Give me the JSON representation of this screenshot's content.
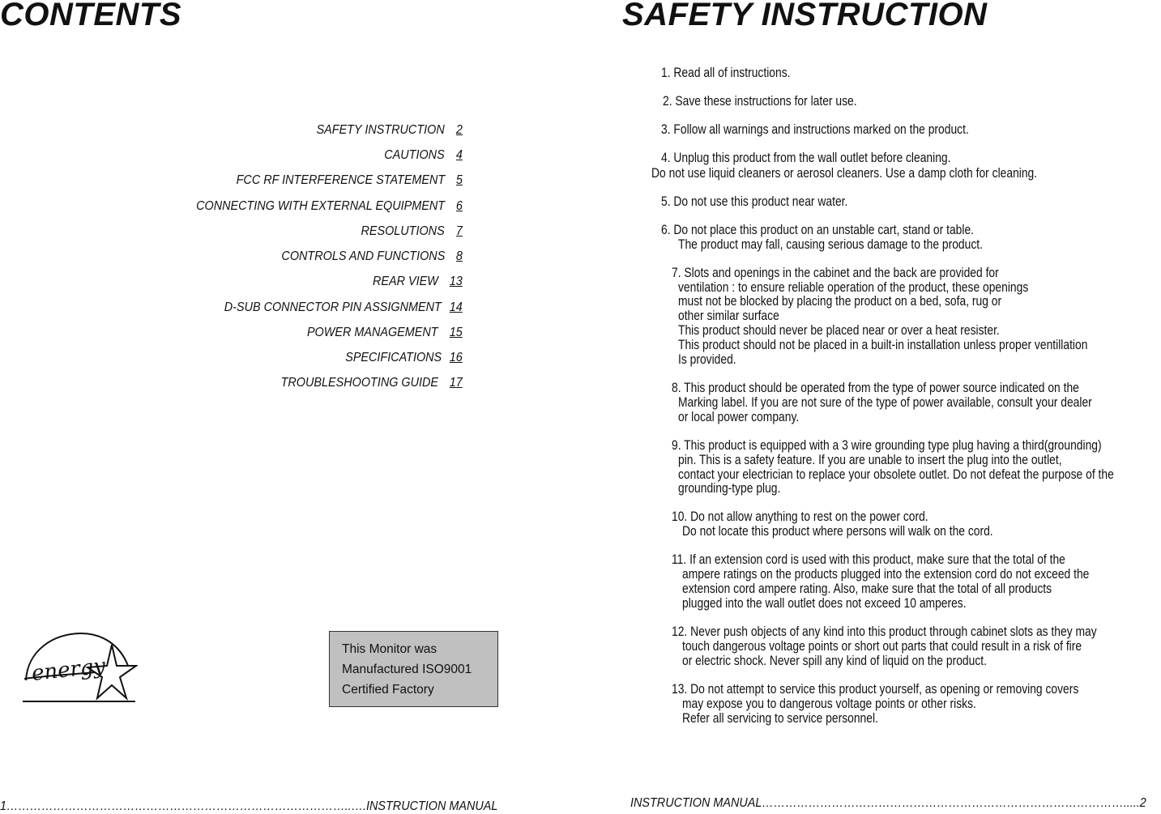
{
  "left_page": {
    "title": "CONTENTS",
    "toc": [
      {
        "title": "SAFETY INSTRUCTION",
        "page": "2"
      },
      {
        "title": "CAUTIONS",
        "page": "4"
      },
      {
        "title": "FCC RF INTERFERENCE STATEMENT",
        "page": "5"
      },
      {
        "title": "CONNECTING WITH EXTERNAL EQUIPMENT",
        "page": "6"
      },
      {
        "title": "RESOLUTIONS",
        "page": "7"
      },
      {
        "title": "CONTROLS AND FUNCTIONS",
        "page": "8"
      },
      {
        "title": "REAR VIEW",
        "page": "13"
      },
      {
        "title": "D-SUB CONNECTOR PIN ASSIGNMENT",
        "page": "14"
      },
      {
        "title": "POWER MANAGEMENT",
        "page": "15"
      },
      {
        "title": "SPECIFICATIONS",
        "page": "16"
      },
      {
        "title": "TROUBLESHOOTING GUIDE",
        "page": "17"
      }
    ],
    "logo_text": "energy",
    "iso_box": [
      "This Monitor was",
      "Manufactured ISO9001",
      "Certified Factory"
    ],
    "footer": "1……………………………………………………………………………..….INSTRUCTION MANUAL"
  },
  "right_page": {
    "title": "SAFETY INSTRUCTION",
    "lines": [
      "1. Read all of instructions.",
      "2. Save these instructions for later use.",
      "3. Follow all warnings and instructions marked on the product.",
      "4. Unplug this product from the wall outlet before cleaning.",
      "Do not use liquid cleaners or aerosol cleaners. Use a damp cloth for cleaning.",
      "5. Do not use this product near water.",
      "6. Do not place this product on an unstable cart, stand or table.",
      "The product may fall, causing serious damage to the product.",
      "7. Slots and openings in the cabinet and the back are provided for",
      "ventilation : to ensure reliable operation of the product, these openings",
      "must not be blocked by placing the product on a bed, sofa, rug or",
      "other similar surface",
      "This product should never be placed near or over a heat resister.",
      "This product should not be placed in a built-in installation unless proper ventillation",
      "Is provided.",
      "8. This product should be operated from the type of power source indicated on the",
      "Marking label. If you are not sure of the type of power available, consult your dealer",
      "or local power company.",
      "9. This product is equipped with a 3 wire grounding type plug having a third(grounding)",
      "pin. This is a safety feature. If you are unable to insert the plug into the outlet,",
      "contact your electrician to replace your obsolete outlet. Do not defeat the purpose of the",
      "grounding-type plug.",
      "10. Do not allow anything to rest on the power cord.",
      "Do not locate this product where persons will walk on the cord.",
      "11. If an extension cord is used with this product, make sure that the total of the",
      "ampere ratings on the products plugged into the extension cord do not exceed the",
      "extension cord ampere rating. Also, make sure that the total of all products",
      "plugged into the wall outlet does not exceed 10 amperes.",
      "12. Never push objects of any kind into this product through cabinet slots as they may",
      "touch dangerous voltage points or short out parts that could result in a risk of fire",
      "or electric shock. Never spill any kind of liquid on the product.",
      "13. Do not attempt to service this product yourself, as opening or removing covers",
      "may expose you to dangerous voltage points or other risks.",
      "Refer all servicing to service personnel."
    ],
    "footer": "INSTRUCTION MANUAL………………………………………………………………………………….....2"
  }
}
